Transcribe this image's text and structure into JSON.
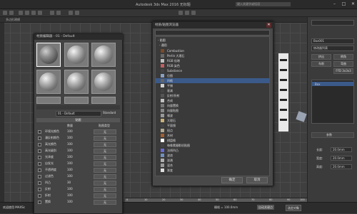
{
  "window": {
    "title": "Autodesk 3ds Max 2016   无标题",
    "search_placeholder": "键入关键字或短语"
  },
  "ribbon": {
    "tabs": [
      "[+] [透视] [真实]"
    ]
  },
  "left_panel": {
    "label": "多边形建模"
  },
  "material_editor": {
    "title": "材质编辑器 - 01 - Default",
    "material_name": "01 - Default",
    "material_type": "Standard",
    "maps_header": "贴图",
    "col_amount": "数量",
    "col_map": "贴图类型",
    "rows": [
      {
        "name": "环境光颜色",
        "amount": "100",
        "map": "无"
      },
      {
        "name": "漫反射颜色",
        "amount": "100",
        "map": "无"
      },
      {
        "name": "高光颜色",
        "amount": "100",
        "map": "无"
      },
      {
        "name": "高光级别",
        "amount": "100",
        "map": "无"
      },
      {
        "name": "光泽度",
        "amount": "100",
        "map": "无"
      },
      {
        "name": "自发光",
        "amount": "100",
        "map": "无"
      },
      {
        "name": "不透明度",
        "amount": "100",
        "map": "无"
      },
      {
        "name": "过滤色",
        "amount": "100",
        "map": "无"
      },
      {
        "name": "凹凸",
        "amount": "30",
        "map": "无"
      },
      {
        "name": "反射",
        "amount": "100",
        "map": "无"
      },
      {
        "name": "折射",
        "amount": "100",
        "map": "无"
      },
      {
        "name": "置换",
        "amount": "100",
        "map": "无"
      }
    ]
  },
  "map_browser": {
    "title": "材质/贴图浏览器",
    "group_header": "- 贴图",
    "subgroup": "- 通用",
    "items": [
      {
        "label": "Combustion",
        "color": "#7a4a2a"
      },
      {
        "label": "Perlin 大理石",
        "color": "#6a6a6a"
      },
      {
        "label": "RGB 倍增",
        "color": "#c0c0c0"
      },
      {
        "label": "RGB 染色",
        "color": "#c06060"
      },
      {
        "label": "Substance",
        "color": "#444"
      },
      {
        "label": "位图",
        "color": "#8aa0c0"
      },
      {
        "label": "凹痕",
        "color": "#666"
      },
      {
        "label": "平铺",
        "color": "#d0d0d0"
      },
      {
        "label": "衰减",
        "color": "#444"
      },
      {
        "label": "反射/折射",
        "color": "#555"
      },
      {
        "label": "合成",
        "color": "#c0c0c0"
      },
      {
        "label": "向量置换",
        "color": "#777"
      },
      {
        "label": "向量贴图",
        "color": "#888"
      },
      {
        "label": "噪波",
        "color": "#999"
      },
      {
        "label": "大理石",
        "color": "#c8b078"
      },
      {
        "label": "平面镜",
        "color": "#444"
      },
      {
        "label": "斑点",
        "color": "#b0a890"
      },
      {
        "label": "木材",
        "color": "#a06030"
      },
      {
        "label": "棋盘格",
        "color": "#fff"
      },
      {
        "label": "每像素摄影机贴图",
        "color": "#444"
      },
      {
        "label": "法线凹凸",
        "color": "#6a6ad0"
      },
      {
        "label": "波浪",
        "color": "#7090c0"
      },
      {
        "label": "泼溅",
        "color": "#b0b0b0"
      },
      {
        "label": "混合",
        "color": "#999"
      },
      {
        "label": "渐变",
        "color": "#ddd"
      }
    ],
    "selected_index": 6,
    "ok_label": "确定",
    "cancel_label": "取消"
  },
  "command_panel": {
    "object_name": "Box001",
    "modifier_list": "修改器列表",
    "buttons": [
      "挤出",
      "倒角",
      "车削",
      "弯曲",
      "FFD 3x3x3"
    ],
    "stack_item": "Box",
    "rollout_title": "参数",
    "fields": [
      {
        "label": "长度:",
        "value": "20.0mm"
      },
      {
        "label": "宽度:",
        "value": "20.0mm"
      },
      {
        "label": "高度:",
        "value": "20.0mm"
      }
    ]
  },
  "statusbar": {
    "left_text": "欢迎使用 MAXSc",
    "grid_label": "栅格 = 100.0mm",
    "auto_key": "自动关键点",
    "selected": "选定对象"
  },
  "timeline": {
    "ticks": [
      "0",
      "10",
      "20",
      "30",
      "40",
      "50",
      "60",
      "70",
      "80",
      "90",
      "100"
    ]
  }
}
